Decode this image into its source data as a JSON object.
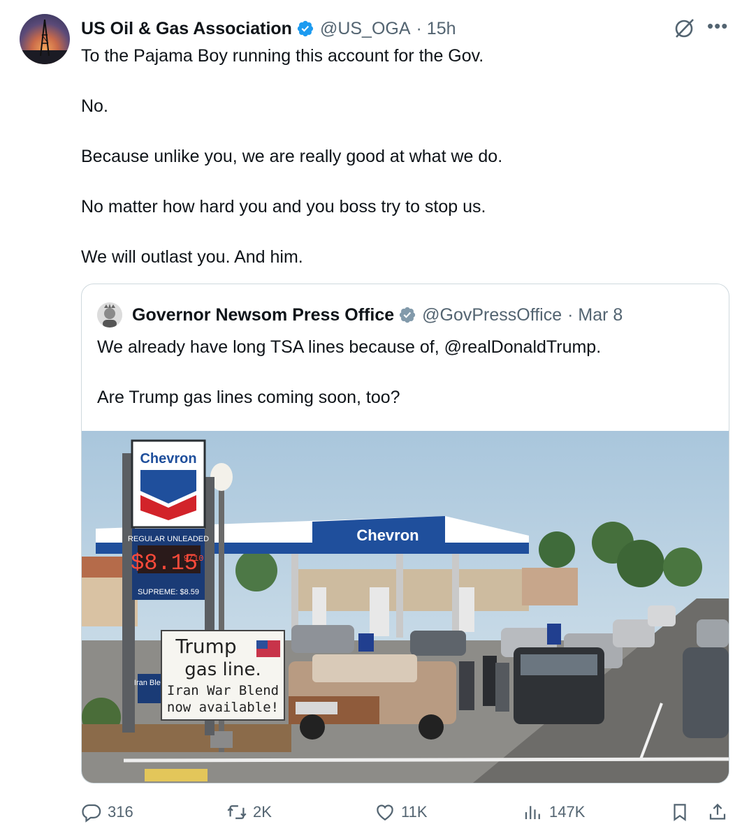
{
  "tweet": {
    "author_name": "US Oil & Gas Association",
    "author_handle": "@US_OGA",
    "time": "· 15h",
    "lines": [
      "To the Pajama Boy running this account for the Gov.",
      "No.",
      "Because unlike you, we are really good at what we do.",
      "No matter how hard you and you boss try to stop us.",
      "We will outlast you. And him."
    ]
  },
  "quote": {
    "author_name": "Governor Newsom Press Office",
    "author_handle": "@GovPressOffice",
    "time": "· Mar 8",
    "lines": [
      "We already have long TSA lines because of, @realDonaldTrump.",
      "Are Trump gas lines coming soon, too?"
    ],
    "image": {
      "brand_sign": "Chevron",
      "canopy_brand": "Chevron",
      "price_label": "REGULAR UNLEADED",
      "price": "$8.15",
      "price_fraction": "9/10",
      "supreme_label": "SUPREME: $8.59",
      "sign_line1": "Trump",
      "sign_line2": "gas line.",
      "sign_line3": "Iran War Blend",
      "sign_line4": "now available!",
      "side_sign": "Iran Blend"
    }
  },
  "actions": {
    "replies": "316",
    "reposts": "2K",
    "likes": "11K",
    "views": "147K"
  },
  "colors": {
    "text": "#0f1419",
    "secondary": "#536471",
    "verified": "#1d9bf0",
    "border": "#cfd9de"
  }
}
